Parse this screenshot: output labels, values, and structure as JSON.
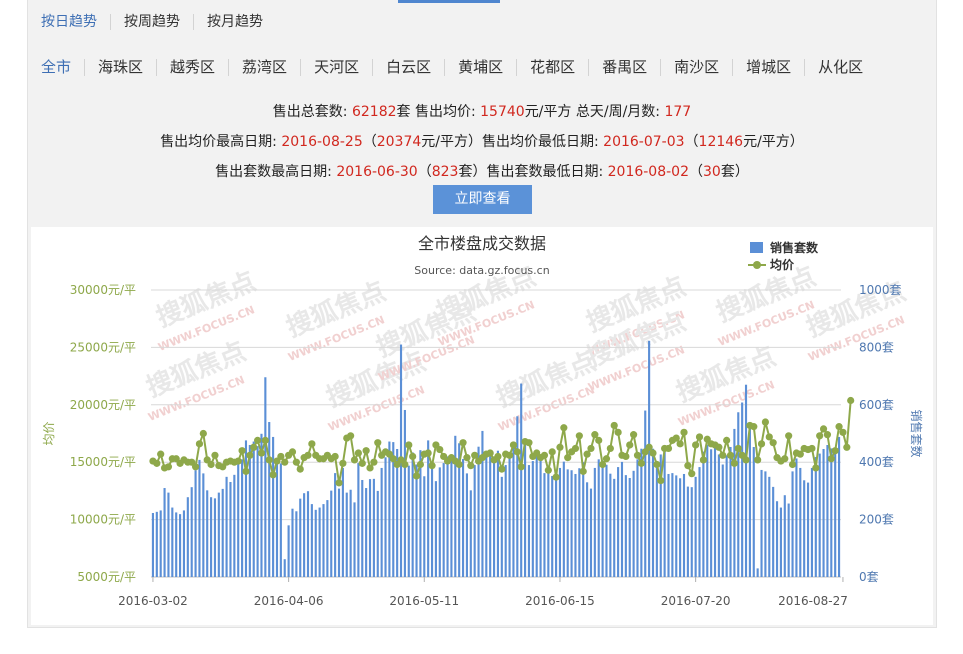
{
  "trend_tabs": [
    "按日趋势",
    "按周趋势",
    "按月趋势"
  ],
  "districts": [
    "全市",
    "海珠区",
    "越秀区",
    "荔湾区",
    "天河区",
    "白云区",
    "黄埔区",
    "花都区",
    "番禺区",
    "南沙区",
    "增城区",
    "从化区"
  ],
  "stats": {
    "line1": {
      "l1": "售出总套数: ",
      "v1": "62182",
      "l2": "套 售出均价: ",
      "v2": "15740",
      "l3": "元/平方 总天/周/月数: ",
      "v3": "177"
    },
    "line2": {
      "l1": "售出均价最高日期: ",
      "v1": "2016-08-25",
      "l2": "（",
      "v2": "20374",
      "l3": "元/平方）售出均价最低日期: ",
      "v3": "2016-07-03",
      "l4": "（",
      "v4": "12146",
      "l5": "元/平方）"
    },
    "line3": {
      "l1": "售出套数最高日期: ",
      "v1": "2016-06-30",
      "l2": "（",
      "v2": "823",
      "l3": "套）售出套数最低日期: ",
      "v3": "2016-08-02",
      "l4": "（",
      "v4": "30",
      "l5": "套）"
    }
  },
  "view_button": "立即查看",
  "watermark": {
    "cn": "搜狐焦点",
    "en": "WWW.FOCUS.CN"
  },
  "colors": {
    "bar": "#5b8fd6",
    "line": "#8ea84a",
    "accent_red": "#d1281f",
    "button": "#5b92d8",
    "tab_active": "#3e6fb4"
  },
  "chart_data": {
    "type": "bar+line",
    "title": "全市楼盘成交数据",
    "subtitle": "Source: data.gz.focus.cn",
    "legend": {
      "bar": "销售套数",
      "line": "均价",
      "position": "top-right"
    },
    "y_left": {
      "label": "均价",
      "min": 5000,
      "max": 30000,
      "ticks": [
        "5000元/平",
        "10000元/平",
        "15000元/平",
        "20000元/平",
        "25000元/平",
        "30000元/平"
      ]
    },
    "y_right": {
      "label": "销售套数",
      "min": 0,
      "max": 1000,
      "ticks": [
        "0套",
        "200套",
        "400套",
        "600套",
        "800套",
        "1000套"
      ]
    },
    "x_tick_labels": [
      "2016-03-02",
      "2016-04-06",
      "2016-05-11",
      "2016-06-15",
      "2016-07-20",
      "2016-08-27"
    ],
    "grid": true,
    "x_start_date": "2016-03-02",
    "sales_units": [
      223,
      227,
      232,
      310,
      294,
      242,
      225,
      219,
      232,
      278,
      313,
      372,
      408,
      361,
      302,
      278,
      274,
      294,
      307,
      349,
      331,
      356,
      394,
      410,
      476,
      460,
      472,
      456,
      499,
      696,
      540,
      488,
      396,
      396,
      62,
      180,
      238,
      229,
      273,
      292,
      299,
      254,
      234,
      242,
      254,
      268,
      301,
      362,
      308,
      380,
      294,
      304,
      260,
      397,
      338,
      310,
      341,
      342,
      300,
      380,
      417,
      472,
      470,
      446,
      810,
      582,
      388,
      434,
      392,
      442,
      351,
      476,
      385,
      334,
      382,
      397,
      420,
      423,
      492,
      466,
      411,
      361,
      302,
      390,
      454,
      509,
      420,
      430,
      400,
      440,
      349,
      390,
      422,
      461,
      560,
      674,
      466,
      390,
      404,
      440,
      421,
      362,
      364,
      352,
      344,
      380,
      402,
      375,
      372,
      359,
      379,
      400,
      330,
      308,
      380,
      410,
      405,
      391,
      360,
      342,
      383,
      401,
      355,
      345,
      370,
      410,
      447,
      580,
      823,
      447,
      403,
      427,
      455,
      359,
      362,
      354,
      344,
      359,
      315,
      313,
      349,
      383,
      437,
      461,
      445,
      450,
      427,
      392,
      424,
      453,
      516,
      574,
      608,
      670,
      532,
      453,
      30,
      373,
      368,
      349,
      314,
      264,
      242,
      285,
      256,
      368,
      413,
      380,
      337,
      329,
      380,
      418,
      430,
      446,
      460,
      448,
      433,
      488
    ],
    "avg_price": [
      15100,
      14900,
      15700,
      14500,
      14600,
      15300,
      15300,
      14900,
      15200,
      15000,
      15000,
      14600,
      16600,
      17500,
      15200,
      14800,
      15600,
      14700,
      14600,
      15000,
      15100,
      15000,
      15100,
      16000,
      14200,
      15600,
      16300,
      16900,
      15800,
      16900,
      15200,
      13900,
      15100,
      15500,
      15000,
      15600,
      15900,
      15000,
      14400,
      15400,
      15600,
      16600,
      15600,
      15300,
      15300,
      15600,
      15300,
      15500,
      13200,
      14900,
      17100,
      17300,
      15200,
      15800,
      14900,
      16000,
      14500,
      15000,
      16700,
      15600,
      15900,
      15700,
      15300,
      14800,
      15200,
      14800,
      16500,
      15500,
      13800,
      14800,
      15700,
      15800,
      14700,
      16500,
      16100,
      15500,
      15100,
      15400,
      15100,
      14800,
      16700,
      15400,
      14700,
      15600,
      15100,
      15400,
      15700,
      15800,
      15200,
      15500,
      14400,
      15700,
      15600,
      16500,
      15900,
      14600,
      16800,
      16700,
      15500,
      15800,
      15400,
      15600,
      14300,
      15900,
      13700,
      16300,
      18000,
      15400,
      15900,
      16200,
      17300,
      14200,
      15700,
      16200,
      17400,
      16900,
      14800,
      15300,
      16200,
      18200,
      17600,
      15600,
      15500,
      16500,
      17400,
      15600,
      14900,
      15900,
      16300,
      15800,
      14800,
      13400,
      16200,
      16200,
      16900,
      17100,
      16600,
      17600,
      14700,
      14000,
      16500,
      17200,
      15200,
      17000,
      16600,
      16500,
      16300,
      15600,
      16900,
      15600,
      14900,
      16200,
      15600,
      15200,
      18200,
      18100,
      15200,
      16600,
      18500,
      17200,
      16700,
      15400,
      15100,
      15300,
      17300,
      14800,
      15800,
      15700,
      16200,
      16100,
      16200,
      14500,
      17300,
      17900,
      17400,
      15300,
      16000,
      18100,
      17600,
      16300,
      20374
    ]
  }
}
